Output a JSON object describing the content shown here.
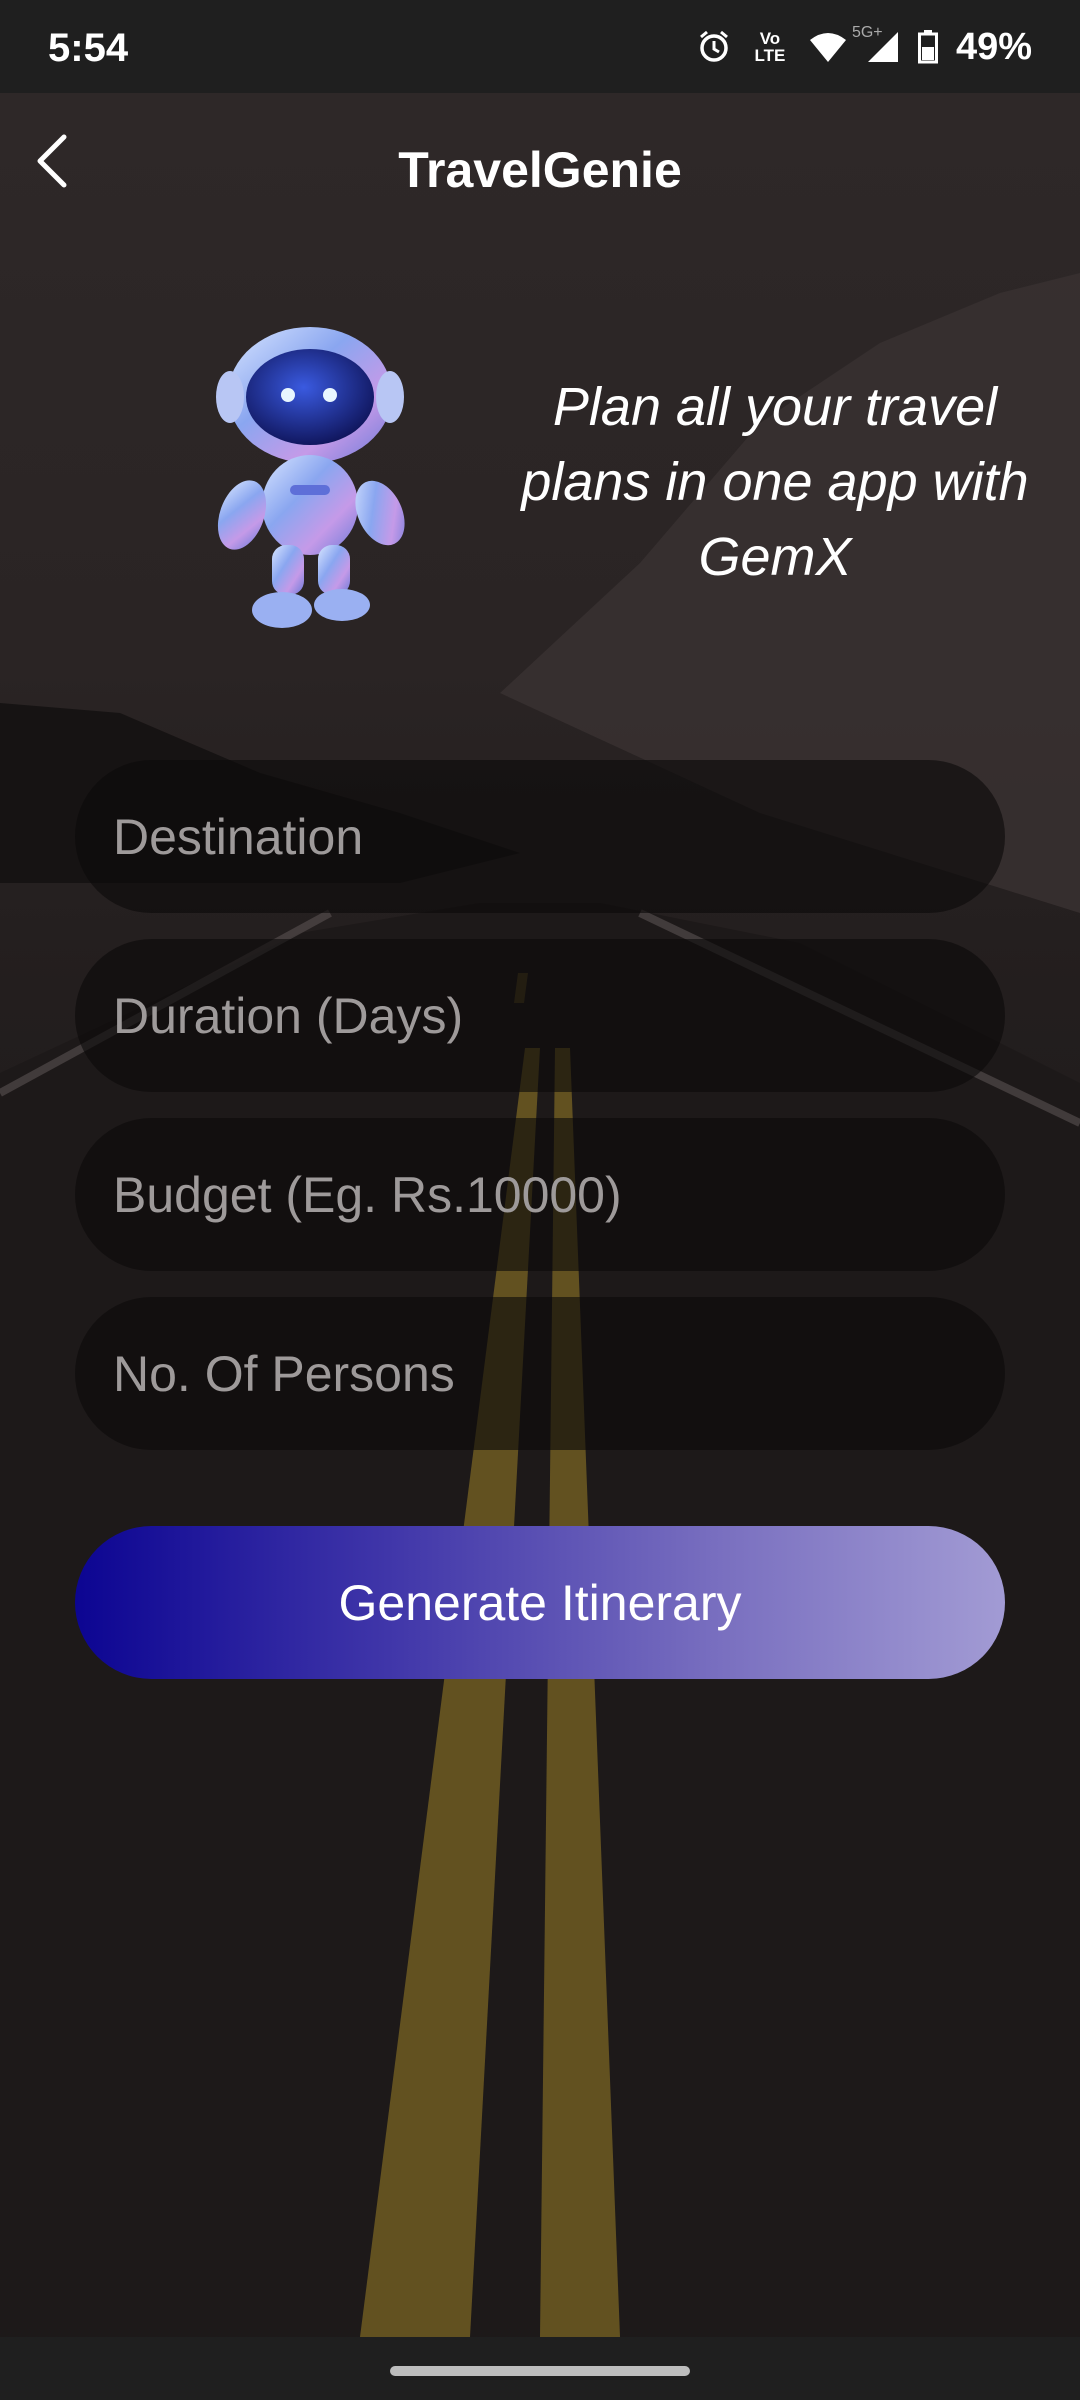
{
  "status_bar": {
    "time": "5:54",
    "network_label": "Vo LTE",
    "signal_label": "5G+",
    "battery": "49%"
  },
  "header": {
    "title": "TravelGenie",
    "back_icon": "chevron-left-icon"
  },
  "hero": {
    "tagline": "Plan all your travel plans in one app with GemX",
    "illustration_icon": "robot-mascot-icon"
  },
  "form": {
    "destination_placeholder": "Destination",
    "duration_placeholder": "Duration (Days)",
    "budget_placeholder": "Budget (Eg. Rs.10000)",
    "persons_placeholder": "No. Of Persons",
    "submit_label": "Generate Itinerary"
  },
  "colors": {
    "button_gradient_start": "#0c0592",
    "button_gradient_end": "#a29bd4",
    "field_background": "#0c0a0a",
    "placeholder_text": "#9e9a9a"
  }
}
